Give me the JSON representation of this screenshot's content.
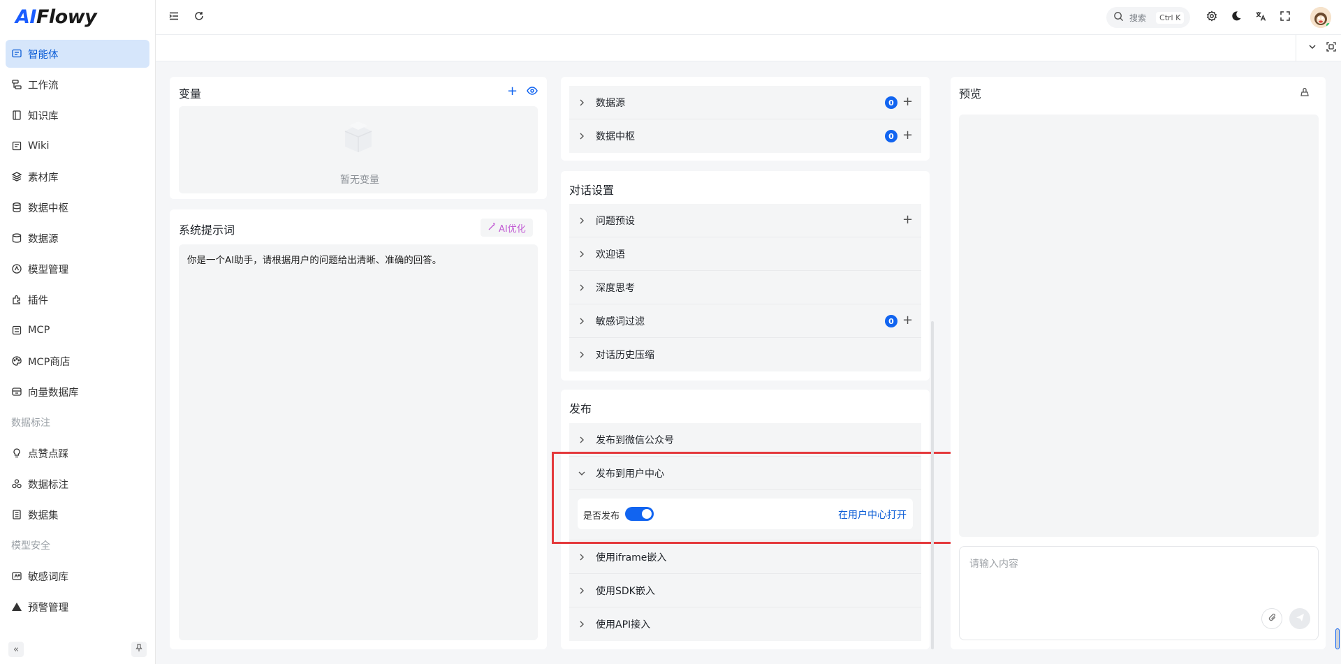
{
  "app": {
    "logo_ai": "AI",
    "logo_rest": "Flowy"
  },
  "sidebar": {
    "items": [
      {
        "label": "智能体",
        "icon": "chat-icon",
        "active": true
      },
      {
        "label": "工作流",
        "icon": "workflow-icon"
      },
      {
        "label": "知识库",
        "icon": "book-icon"
      },
      {
        "label": "Wiki",
        "icon": "wiki-icon"
      },
      {
        "label": "素材库",
        "icon": "layers-icon"
      },
      {
        "label": "数据中枢",
        "icon": "database-icon"
      },
      {
        "label": "数据源",
        "icon": "datasource-icon"
      },
      {
        "label": "模型管理",
        "icon": "model-icon"
      },
      {
        "label": "插件",
        "icon": "plugin-icon"
      },
      {
        "label": "MCP",
        "icon": "mcp-icon"
      },
      {
        "label": "MCP商店",
        "icon": "palette-icon"
      },
      {
        "label": "向量数据库",
        "icon": "vector-db-icon"
      }
    ],
    "group_data_label": "数据标注",
    "data_items": [
      {
        "label": "点赞点踩",
        "icon": "bulb-icon"
      },
      {
        "label": "数据标注",
        "icon": "tag-icon"
      },
      {
        "label": "数据集",
        "icon": "dataset-icon"
      }
    ],
    "group_model_security": "模型安全",
    "security_items": [
      {
        "label": "敏感词库",
        "icon": "sensitive-icon"
      },
      {
        "label": "预警管理",
        "icon": "warning-icon"
      }
    ]
  },
  "header": {
    "search_placeholder": "搜索",
    "search_shortcut": "Ctrl K"
  },
  "variables": {
    "title": "变量",
    "empty_text": "暂无变量"
  },
  "system_prompt": {
    "title": "系统提示词",
    "ai_optimize": "AI优化",
    "text": "你是一个AI助手，请根据用户的问题给出清晰、准确的回答。"
  },
  "top_rows": [
    {
      "label": "数据源",
      "count": "0"
    },
    {
      "label": "数据中枢",
      "count": "0"
    }
  ],
  "dialog_settings": {
    "title": "对话设置",
    "rows": [
      {
        "label": "问题预设"
      },
      {
        "label": "欢迎语"
      },
      {
        "label": "深度思考"
      },
      {
        "label": "敏感词过滤",
        "count": "0"
      },
      {
        "label": "对话历史压缩"
      }
    ]
  },
  "publish": {
    "title": "发布",
    "rows": [
      {
        "label": "发布到微信公众号"
      },
      {
        "label": "发布到用户中心",
        "expanded": true
      },
      {
        "label": "使用iframe嵌入"
      },
      {
        "label": "使用SDK嵌入"
      },
      {
        "label": "使用API接入"
      }
    ],
    "is_publish_label": "是否发布",
    "is_published": true,
    "open_link": "在用户中心打开"
  },
  "preview": {
    "title": "预览",
    "input_placeholder": "请输入内容"
  },
  "colors": {
    "accent": "#1164f0",
    "active_bg": "#d6e6fb",
    "highlight": "#e4393c"
  }
}
